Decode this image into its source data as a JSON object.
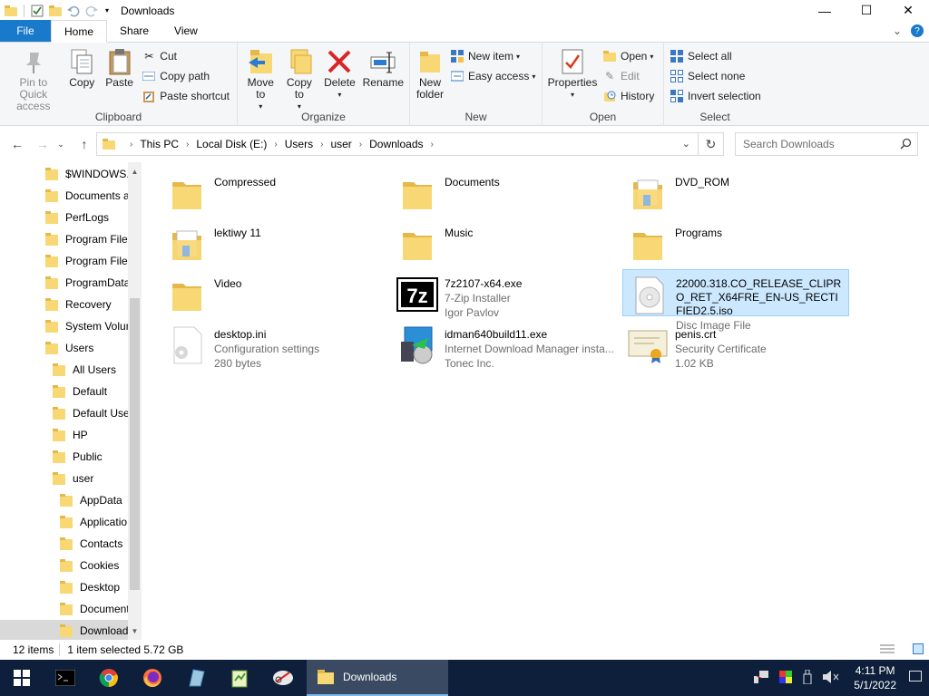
{
  "window": {
    "title": "Downloads",
    "buttons": {
      "minimize": "—",
      "maximize": "☐",
      "close": "✕"
    }
  },
  "tabs": [
    "File",
    "Home",
    "Share",
    "View"
  ],
  "ribbon": {
    "clipboard": {
      "label": "Clipboard",
      "pin": "Pin to Quick access",
      "copy": "Copy",
      "paste": "Paste",
      "cut": "Cut",
      "copy_path": "Copy path",
      "paste_shortcut": "Paste shortcut"
    },
    "organize": {
      "label": "Organize",
      "move_to": "Move to",
      "copy_to": "Copy to",
      "delete": "Delete",
      "rename": "Rename"
    },
    "new": {
      "label": "New",
      "new_folder": "New folder",
      "new_item": "New item",
      "easy_access": "Easy access"
    },
    "open": {
      "label": "Open",
      "properties": "Properties",
      "open": "Open",
      "edit": "Edit",
      "history": "History"
    },
    "select": {
      "label": "Select",
      "select_all": "Select all",
      "select_none": "Select none",
      "invert_selection": "Invert selection"
    }
  },
  "address": {
    "crumbs": [
      "This PC",
      "Local Disk (E:)",
      "Users",
      "user",
      "Downloads"
    ],
    "search_placeholder": "Search Downloads"
  },
  "nav_tree": [
    {
      "label": "$WINDOWS.~",
      "indent": 0
    },
    {
      "label": "Documents a",
      "indent": 0
    },
    {
      "label": "PerfLogs",
      "indent": 0
    },
    {
      "label": "Program Files",
      "indent": 0
    },
    {
      "label": "Program Files",
      "indent": 0
    },
    {
      "label": "ProgramData",
      "indent": 0
    },
    {
      "label": "Recovery",
      "indent": 0
    },
    {
      "label": "System Volum",
      "indent": 0
    },
    {
      "label": "Users",
      "indent": 0
    },
    {
      "label": "All Users",
      "indent": 1
    },
    {
      "label": "Default",
      "indent": 1
    },
    {
      "label": "Default User",
      "indent": 1
    },
    {
      "label": "HP",
      "indent": 1
    },
    {
      "label": "Public",
      "indent": 1
    },
    {
      "label": "user",
      "indent": 1
    },
    {
      "label": "AppData",
      "indent": 2
    },
    {
      "label": "Applicatio",
      "indent": 2
    },
    {
      "label": "Contacts",
      "indent": 2
    },
    {
      "label": "Cookies",
      "indent": 2
    },
    {
      "label": "Desktop",
      "indent": 2
    },
    {
      "label": "Document",
      "indent": 2
    },
    {
      "label": "Download",
      "indent": 2
    }
  ],
  "files": [
    {
      "name": "Compressed",
      "type": "folder"
    },
    {
      "name": "Documents",
      "type": "folder"
    },
    {
      "name": "DVD_ROM",
      "type": "folder-doc"
    },
    {
      "name": "lektiwy 11",
      "type": "folder-doc"
    },
    {
      "name": "Music",
      "type": "folder"
    },
    {
      "name": "Programs",
      "type": "folder"
    },
    {
      "name": "Video",
      "type": "folder"
    },
    {
      "name": "7z2107-x64.exe",
      "type": "7zip",
      "line2": "7-Zip Installer",
      "line3": "Igor Pavlov"
    },
    {
      "name": "22000.318.CO_RELEASE_CLIPRO_RET_X64FRE_EN-US_RECTIFIED2.5.iso",
      "type": "iso",
      "line2": "Disc Image File",
      "selected": true
    },
    {
      "name": "desktop.ini",
      "type": "ini",
      "line2": "Configuration settings",
      "line3": "280 bytes"
    },
    {
      "name": "idman640build11.exe",
      "type": "idm",
      "line2": "Internet Download Manager insta...",
      "line3": "Tonec Inc."
    },
    {
      "name": "penis.crt",
      "type": "cert",
      "line2": "Security Certificate",
      "line3": "1.02 KB"
    }
  ],
  "status": {
    "count": "12 items",
    "selected": "1 item selected  5.72 GB"
  },
  "taskbar": {
    "active_label": "Downloads",
    "time": "4:11 PM",
    "date": "5/1/2022"
  }
}
